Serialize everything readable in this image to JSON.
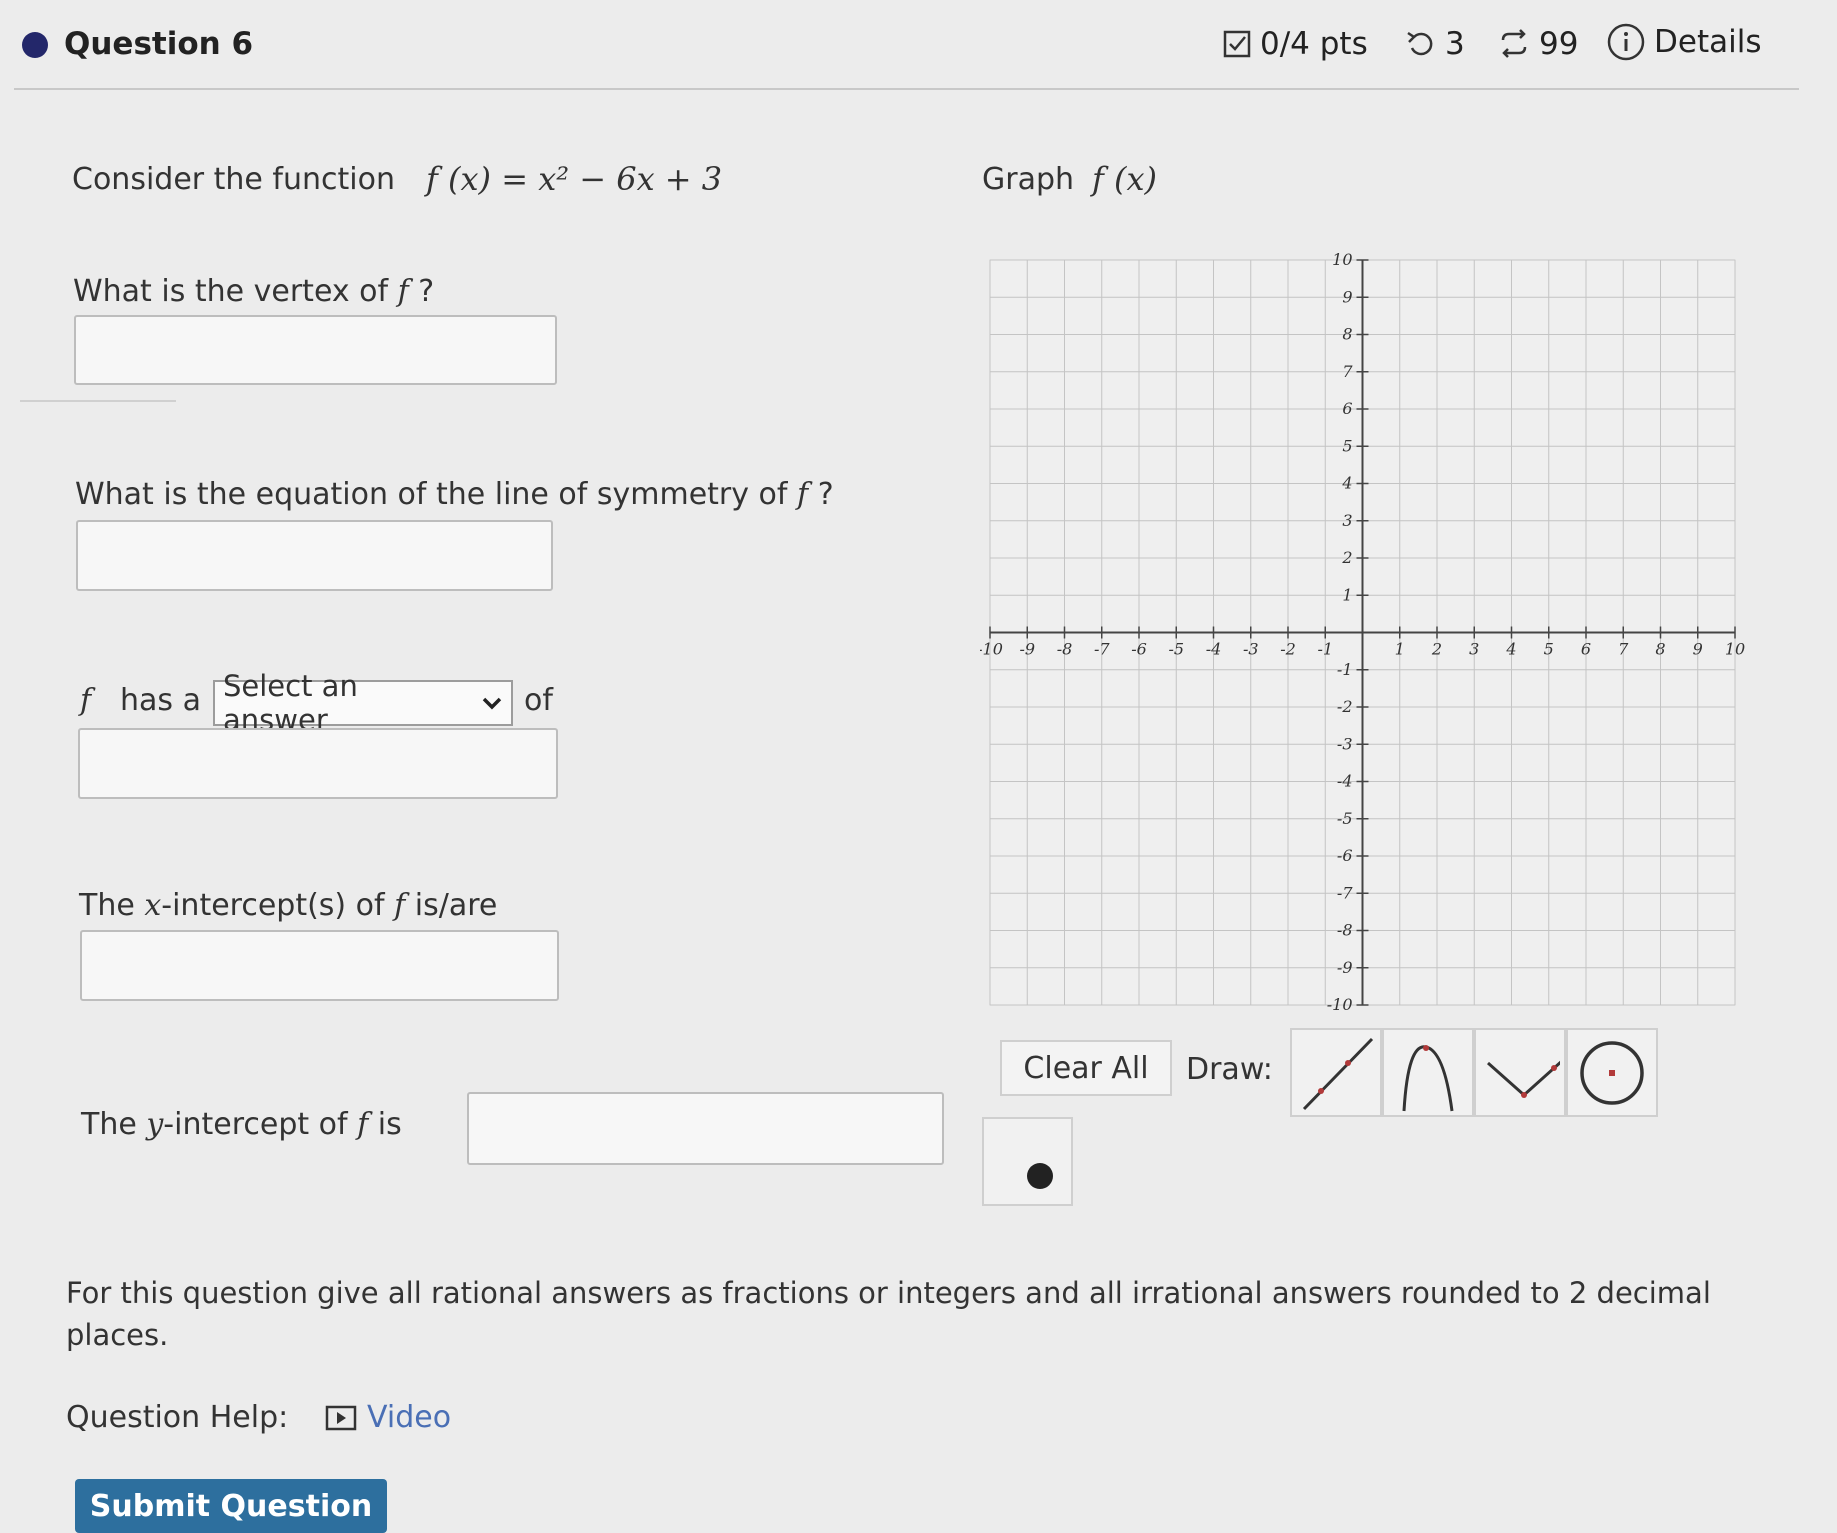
{
  "header": {
    "question_title": "Question 6",
    "points": "0/4 pts",
    "retries": "3",
    "attempts": "99",
    "details": "Details"
  },
  "prompt": {
    "intro": "Consider the function",
    "function": "f (x) = x² − 6x + 3",
    "graph_label": "Graph",
    "graph_fn": "f (x)"
  },
  "questions": {
    "vertex": {
      "text": "What is the vertex of",
      "fn": "f",
      "tail": "?",
      "value": ""
    },
    "symmetry": {
      "text": "What is the equation of the line of symmetry of",
      "fn": "f",
      "tail": "?",
      "value": ""
    },
    "extremum": {
      "fn": "f",
      "has_a": "has a",
      "select_value": "Select an answer",
      "of": "of",
      "value": ""
    },
    "x_intercepts": {
      "pre": "The",
      "var": "x",
      "mid": "-intercept(s) of",
      "fn": "f",
      "tail": "is/are",
      "value": ""
    },
    "y_intercept": {
      "pre": "The",
      "var": "y",
      "mid": "-intercept of",
      "fn": "f",
      "tail": "is",
      "value": ""
    }
  },
  "graph": {
    "x_min": -10,
    "x_max": 10,
    "y_min": -10,
    "y_max": 10,
    "grid": true,
    "x_ticks": [
      "-10",
      "-9",
      "-8",
      "-7",
      "-6",
      "-5",
      "-4",
      "-3",
      "-2",
      "-1",
      "1",
      "2",
      "3",
      "4",
      "5",
      "6",
      "7",
      "8",
      "9",
      "10"
    ],
    "y_ticks": [
      "10",
      "9",
      "8",
      "7",
      "6",
      "5",
      "4",
      "3",
      "2",
      "1",
      "-1",
      "-2",
      "-3",
      "-4",
      "-5",
      "-6",
      "-7",
      "-8",
      "-9",
      "-10"
    ]
  },
  "tools": {
    "clear_all": "Clear All",
    "draw_label": "Draw:",
    "items": [
      "line-tool-icon",
      "parabola-down-tool-icon",
      "parabola-up-tool-icon",
      "circle-tool-icon",
      "point-tool-icon"
    ]
  },
  "footer": {
    "instructions": "For this question give all rational answers as fractions or integers and all irrational answers rounded to 2 decimal places.",
    "help_label": "Question Help:",
    "video": "Video",
    "submit": "Submit Question"
  },
  "colors": {
    "dot": "#23276a",
    "accent_tool": "#b23a3a",
    "link": "#4a6fb5",
    "submit": "#2d6f9e"
  }
}
